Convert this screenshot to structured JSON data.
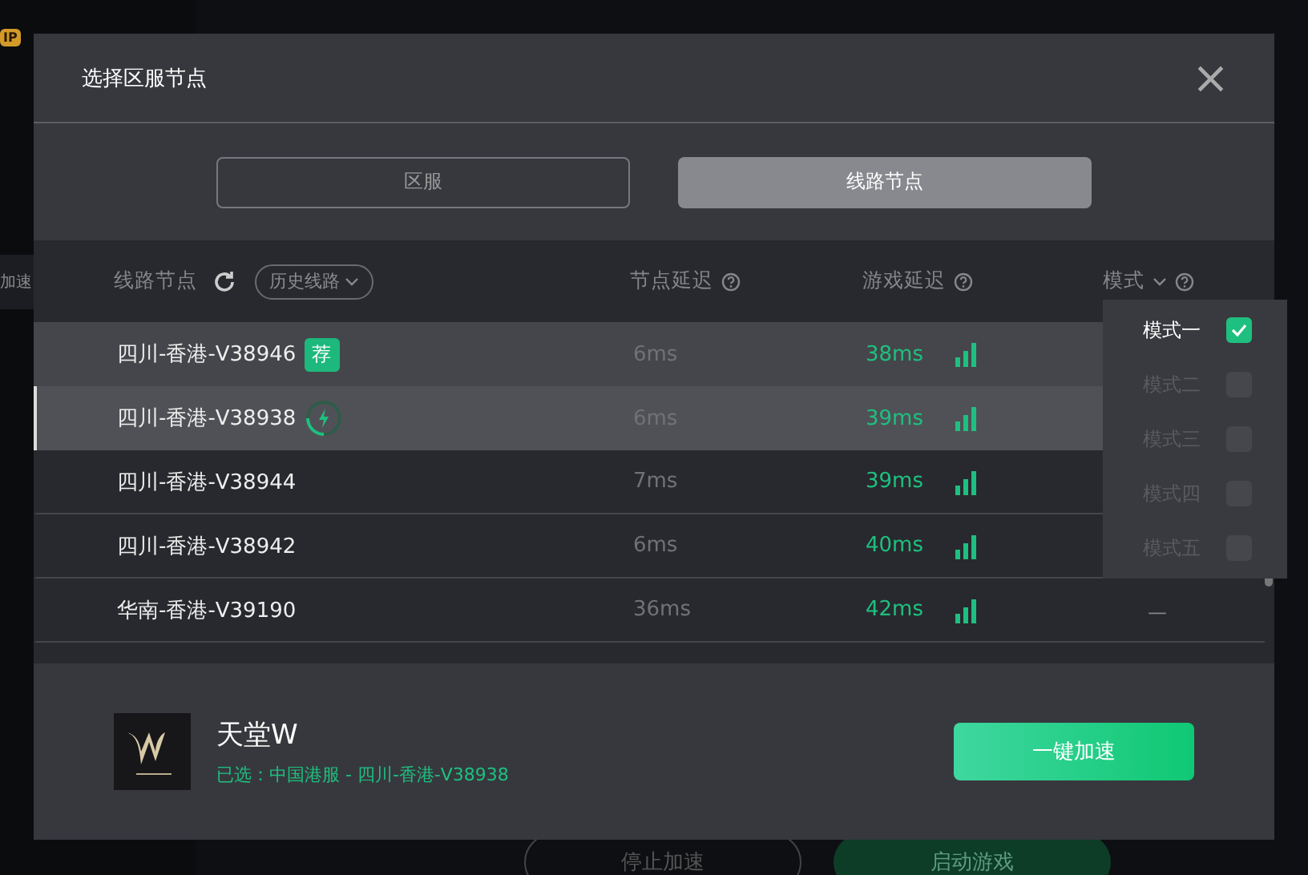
{
  "background": {
    "vip_badge": "IP",
    "sidebar_item": "加速",
    "stop_button": "停止加速",
    "launch_button": "启动游戏"
  },
  "dialog": {
    "title": "选择区服节点",
    "close": "×"
  },
  "tabs": [
    {
      "label": "区服",
      "selected": false
    },
    {
      "label": "线路节点",
      "selected": true
    }
  ],
  "table": {
    "columns": [
      {
        "label": "线路节点"
      },
      {
        "label": "节点延迟"
      },
      {
        "label": "游戏延迟"
      },
      {
        "label": "模式"
      }
    ],
    "history_button": "历史线路",
    "rows": [
      {
        "name": "四川-香港-V38946",
        "node_latency": "6ms",
        "game_latency": "38ms",
        "badge": "荐",
        "loading": false,
        "selected": false,
        "hovered": true
      },
      {
        "name": "四川-香港-V38938",
        "node_latency": "6ms",
        "game_latency": "39ms",
        "loading": true,
        "selected": true,
        "hovered": false
      },
      {
        "name": "四川-香港-V38944",
        "node_latency": "7ms",
        "game_latency": "39ms",
        "loading": false,
        "selected": false,
        "hovered": false
      },
      {
        "name": "四川-香港-V38942",
        "node_latency": "6ms",
        "game_latency": "40ms",
        "loading": false,
        "selected": false,
        "hovered": false
      },
      {
        "name": "华南-香港-V39190",
        "node_latency": "36ms",
        "game_latency": "42ms",
        "mode": "—",
        "loading": false,
        "selected": false,
        "hovered": false
      }
    ]
  },
  "mode_menu": [
    {
      "label": "模式一",
      "checked": true
    },
    {
      "label": "模式二",
      "checked": false
    },
    {
      "label": "模式三",
      "checked": false
    },
    {
      "label": "模式四",
      "checked": false
    },
    {
      "label": "模式五",
      "checked": false
    }
  ],
  "footer": {
    "game_title": "天堂W",
    "selection": "已选：中国港服 - 四川-香港-V38938",
    "accelerate_button": "一键加速"
  }
}
